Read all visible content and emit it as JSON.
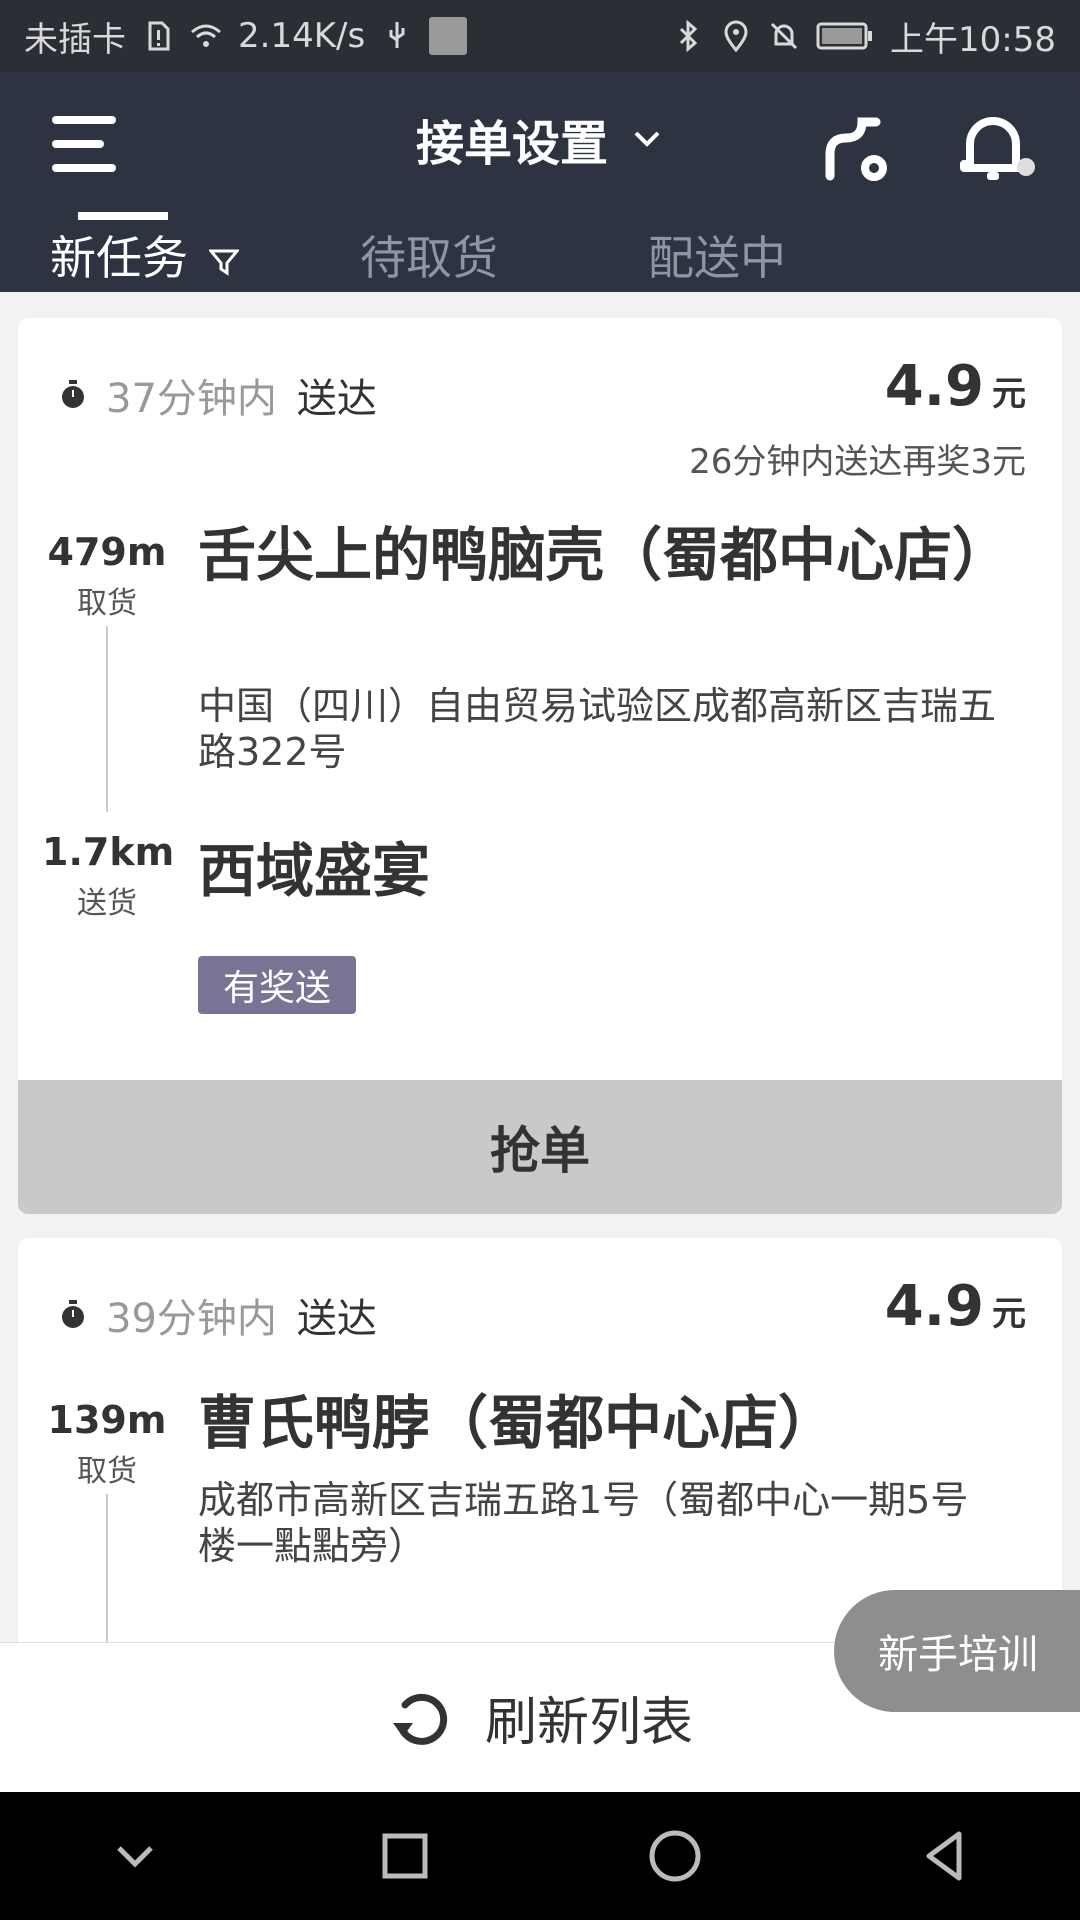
{
  "status_bar": {
    "carrier": "未插卡",
    "speed": "2.14K/s",
    "time": "上午10:58"
  },
  "header": {
    "title": "接单设置"
  },
  "tabs": [
    {
      "label": "新任务",
      "active": true
    },
    {
      "label": "待取货",
      "active": false
    },
    {
      "label": "配送中",
      "active": false
    }
  ],
  "orders": [
    {
      "time_gray": "37分钟内",
      "time_dark": "送达",
      "price": "4.9",
      "unit": "元",
      "bonus": "26分钟内送达再奖3元",
      "pickup_distance": "479m",
      "pickup_label": "取货",
      "pickup_name": "舌尖上的鸭脑壳（蜀都中心店）",
      "pickup_address": "中国（四川）自由贸易试验区成都高新区吉瑞五路322号",
      "delivery_distance": "1.7km",
      "delivery_label": "送货",
      "delivery_name": "西域盛宴",
      "tag": "有奖送",
      "grab_label": "抢单"
    },
    {
      "time_gray": "39分钟内",
      "time_dark": "送达",
      "price": "4.9",
      "unit": "元",
      "pickup_distance": "139m",
      "pickup_label": "取货",
      "pickup_name": "曹氏鸭脖（蜀都中心店）",
      "pickup_address": "成都市高新区吉瑞五路1号（蜀都中心一期5号楼一點點旁）"
    }
  ],
  "refresh_label": "刷新列表",
  "trainer_label": "新手培训"
}
